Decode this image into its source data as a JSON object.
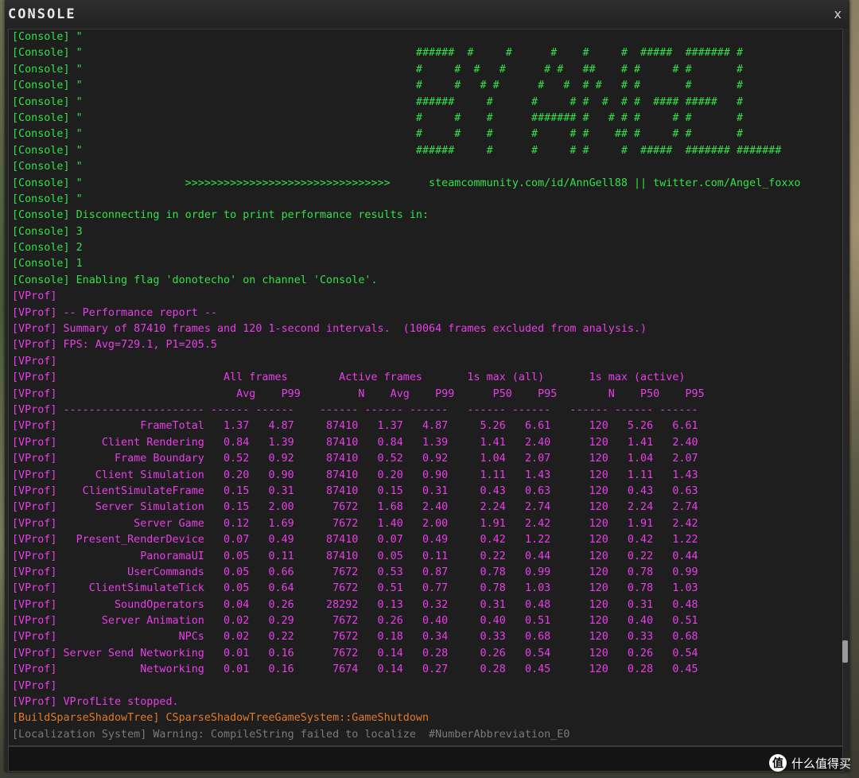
{
  "window": {
    "title": "CONSOLE",
    "close_glyph": "x"
  },
  "colors": {
    "console": "#34e048",
    "vprof": "#e83ee8",
    "buildshadow": "#e07a2a"
  },
  "log_lines": [
    {
      "color": "green",
      "text": "[Console] \""
    },
    {
      "color": "green",
      "text": "[Console] \"                                                    ######  #     #      #    #     #  #####  ####### #"
    },
    {
      "color": "green",
      "text": "[Console] \"                                                    #     #  #   #      # #   ##    # #     # #       #"
    },
    {
      "color": "green",
      "text": "[Console] \"                                                    #     #   # #      #   #  # #   # #       #       #"
    },
    {
      "color": "green",
      "text": "[Console] \"                                                    ######     #      #     # #  #  # #  #### #####   #"
    },
    {
      "color": "green",
      "text": "[Console] \"                                                    #     #    #      ####### #   # # #     # #       #"
    },
    {
      "color": "green",
      "text": "[Console] \"                                                    #     #    #      #     # #    ## #     # #       #"
    },
    {
      "color": "green",
      "text": "[Console] \"                                                    ######     #      #     # #     #  #####  ####### #######"
    },
    {
      "color": "green",
      "text": "[Console] \""
    },
    {
      "color": "green",
      "text": "[Console] \"                >>>>>>>>>>>>>>>>>>>>>>>>>>>>>>>>      steamcommunity.com/id/AnnGell88 || twitter.com/Angel_foxxo"
    },
    {
      "color": "green",
      "text": "[Console] \""
    },
    {
      "color": "green",
      "text": "[Console] Disconnecting in order to print performance results in:"
    },
    {
      "color": "green",
      "text": "[Console] 3"
    },
    {
      "color": "green",
      "text": "[Console] 2"
    },
    {
      "color": "green",
      "text": "[Console] 1"
    },
    {
      "color": "green",
      "text": "[Console] Enabling flag 'donotecho' on channel 'Console'."
    },
    {
      "color": "magenta",
      "text": "[VProf]"
    },
    {
      "color": "magenta",
      "text": "[VProf] -- Performance report --"
    },
    {
      "color": "magenta",
      "text": "[VProf] Summary of 87410 frames and 120 1-second intervals.  (10064 frames excluded from analysis.)"
    },
    {
      "color": "magenta",
      "text": "[VProf] FPS: Avg=729.1, P1=205.5"
    },
    {
      "color": "magenta",
      "text": "[VProf]"
    },
    {
      "color": "magenta",
      "text": "[VProf]                          All frames        Active frames       1s max (all)       1s max (active)"
    },
    {
      "color": "magenta",
      "text": "[VProf]                            Avg    P99         N    Avg    P99      P50    P95        N    P50    P95"
    },
    {
      "color": "magenta",
      "text": "[VProf] ---------------------- ------ ------    ------ ------ ------   ------ ------   ------ ------ ------"
    },
    {
      "color": "magenta",
      "text": "[VProf]             FrameTotal   1.37   4.87     87410   1.37   4.87     5.26   6.61      120   5.26   6.61"
    },
    {
      "color": "magenta",
      "text": "[VProf]       Client Rendering   0.84   1.39     87410   0.84   1.39     1.41   2.40      120   1.41   2.40"
    },
    {
      "color": "magenta",
      "text": "[VProf]         Frame Boundary   0.52   0.92     87410   0.52   0.92     1.04   2.07      120   1.04   2.07"
    },
    {
      "color": "magenta",
      "text": "[VProf]      Client Simulation   0.20   0.90     87410   0.20   0.90     1.11   1.43      120   1.11   1.43"
    },
    {
      "color": "magenta",
      "text": "[VProf]    ClientSimulateFrame   0.15   0.31     87410   0.15   0.31     0.43   0.63      120   0.43   0.63"
    },
    {
      "color": "magenta",
      "text": "[VProf]      Server Simulation   0.15   2.00      7672   1.68   2.40     2.24   2.74      120   2.24   2.74"
    },
    {
      "color": "magenta",
      "text": "[VProf]            Server Game   0.12   1.69      7672   1.40   2.00     1.91   2.42      120   1.91   2.42"
    },
    {
      "color": "magenta",
      "text": "[VProf]   Present_RenderDevice   0.07   0.49     87410   0.07   0.49     0.42   1.22      120   0.42   1.22"
    },
    {
      "color": "magenta",
      "text": "[VProf]             PanoramaUI   0.05   0.11     87410   0.05   0.11     0.22   0.44      120   0.22   0.44"
    },
    {
      "color": "magenta",
      "text": "[VProf]           UserCommands   0.05   0.66      7672   0.53   0.87     0.78   0.99      120   0.78   0.99"
    },
    {
      "color": "magenta",
      "text": "[VProf]     ClientSimulateTick   0.05   0.64      7672   0.51   0.77     0.78   1.03      120   0.78   1.03"
    },
    {
      "color": "magenta",
      "text": "[VProf]         SoundOperators   0.04   0.26     28292   0.13   0.32     0.31   0.48      120   0.31   0.48"
    },
    {
      "color": "magenta",
      "text": "[VProf]       Server Animation   0.02   0.29      7672   0.26   0.40     0.40   0.51      120   0.40   0.51"
    },
    {
      "color": "magenta",
      "text": "[VProf]                   NPCs   0.02   0.22      7672   0.18   0.34     0.33   0.68      120   0.33   0.68"
    },
    {
      "color": "magenta",
      "text": "[VProf] Server Send Networking   0.01   0.16      7672   0.14   0.28     0.26   0.54      120   0.26   0.54"
    },
    {
      "color": "magenta",
      "text": "[VProf]             Networking   0.01   0.16      7674   0.14   0.27     0.28   0.45      120   0.28   0.45"
    },
    {
      "color": "magenta",
      "text": "[VProf]"
    },
    {
      "color": "magenta",
      "text": "[VProf] VProfLite stopped."
    },
    {
      "color": "orange",
      "text": "[BuildSparseShadowTree] CSparseShadowTreeGameSystem::GameShutdown"
    },
    {
      "color": "gray",
      "text": "[Localization System] Warning: CompileString failed to localize  #NumberAbbreviation_E0"
    }
  ],
  "input": {
    "value": ""
  },
  "watermark": {
    "badge": "值",
    "text": "什么值得买"
  }
}
